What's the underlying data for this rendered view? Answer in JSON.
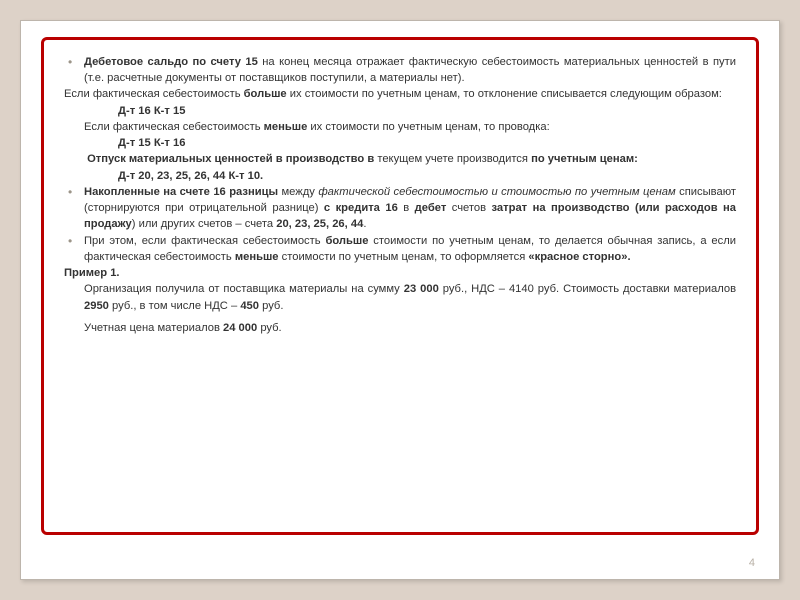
{
  "p1a": "Дебетовое сальдо по счету 15",
  "p1b": " на конец месяца отражает фактическую себестоимость материальных ценностей в пути (т.е. расчетные документы от поставщиков поступили, а материалы нет).",
  "p2a": "Если фактическая себестоимость ",
  "p2b": "больше",
  "p2c": " их стоимости по учетным ценам, то отклонение списывается следующим образом:",
  "p3": "Д-т 16 К-т 15",
  "p4a": "Если фактическая себестоимость ",
  "p4b": "меньше",
  "p4c": " их стоимости по учетным ценам, то проводка:",
  "p5": "Д-т 15 К-т 16",
  "p6a": "Отпуск материальных ценностей в производство в",
  "p6b": " текущем учете производится ",
  "p6c": "по учетным ценам:",
  "p7": "Д-т 20, 23, 25, 26, 44 К-т 10.",
  "p8a": "Накопленные на счете 16 разницы",
  "p8b": " между ",
  "p8c": "фактической себестоимостью и стоимостью по учетным ценам",
  "p8d": " списывают (сторнируются при отрицательной разнице) ",
  "p8e": "с кредита 16",
  "p8f": " в ",
  "p8g": "дебет",
  "p8h": " счетов ",
  "p8i": "затрат на производство (или расходов на продажу",
  "p8j": ") или других счетов – счета ",
  "p8k": "20, 23, 25, 26, 44",
  ".p8l": ".",
  "p9a": "При этом, если фактическая себестоимость ",
  "p9b": "больше",
  "p9c": " стоимости по учетным ценам, то делается обычная запись, а если фактическая себестоимость ",
  "p9d": "меньше",
  "p9e": " стоимости по учетным ценам, то оформляется ",
  "p9f": "«красное сторно».",
  "p10": "Пример 1.",
  "p11a": "Организация получила от поставщика материалы на сумму ",
  "p11b": "23 000",
  "p11c": " руб., НДС – 4140 руб. Стоимость доставки материалов ",
  "p11d": "2950",
  "p11e": " руб., в том числе НДС – ",
  "p11f": "450",
  "p11g": " руб.",
  "p12a": "Учетная цена материалов ",
  "p12b": "24 000",
  "p12c": " руб.",
  "pagenum": "4"
}
